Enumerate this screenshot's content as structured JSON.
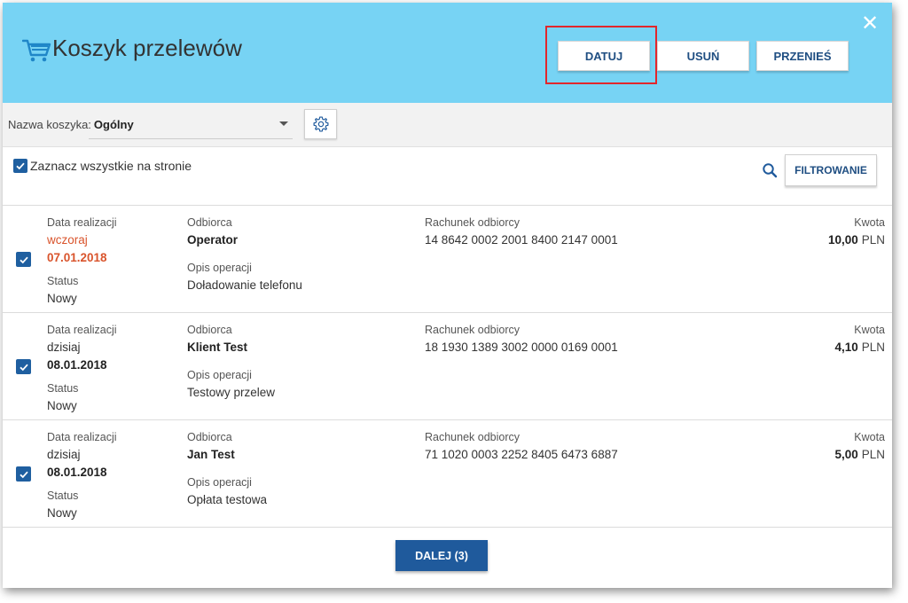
{
  "header": {
    "title": "Koszyk przelewów",
    "buttons": {
      "datuj": "DATUJ",
      "usun": "USUŃ",
      "przenies": "PRZENIEŚ"
    },
    "close_label": "✕",
    "background_color": "#77d3f4",
    "highlight_color": "#e2262b"
  },
  "basket": {
    "label": "Nazwa koszyka:",
    "value": "Ogólny"
  },
  "toolbar": {
    "select_all_label": "Zaznacz wszystkie na stronie",
    "filter_label": "FILTROWANIE"
  },
  "labels": {
    "date": "Data realizacji",
    "status": "Status",
    "recipient": "Odbiorca",
    "description": "Opis operacji",
    "account": "Rachunek odbiorcy",
    "amount": "Kwota"
  },
  "transfers": [
    {
      "date_relative": "wczoraj",
      "date": "07.01.2018",
      "status": "Nowy",
      "recipient": "Operator",
      "description": "Doładowanie telefonu",
      "account": "14 8642 0002 2001 8400 2147 0001",
      "amount": "10,00",
      "currency": "PLN",
      "overdue": true
    },
    {
      "date_relative": "dzisiaj",
      "date": "08.01.2018",
      "status": "Nowy",
      "recipient": "Klient Test",
      "description": "Testowy przelew",
      "account": "18 1930 1389 3002 0000 0169 0001",
      "amount": "4,10",
      "currency": "PLN",
      "overdue": false
    },
    {
      "date_relative": "dzisiaj",
      "date": "08.01.2018",
      "status": "Nowy",
      "recipient": "Jan Test",
      "description": "Opłata testowa",
      "account": "71 1020 0003 2252 8405 6473 6887",
      "amount": "5,00",
      "currency": "PLN",
      "overdue": false
    }
  ],
  "footer": {
    "next_label": "DALEJ (3)",
    "button_color": "#1f5a9c"
  },
  "icons": {
    "cart": "cart-icon",
    "gear": "gear-icon",
    "search": "search-icon",
    "close": "close-icon",
    "checkbox": "checkmark-icon"
  }
}
